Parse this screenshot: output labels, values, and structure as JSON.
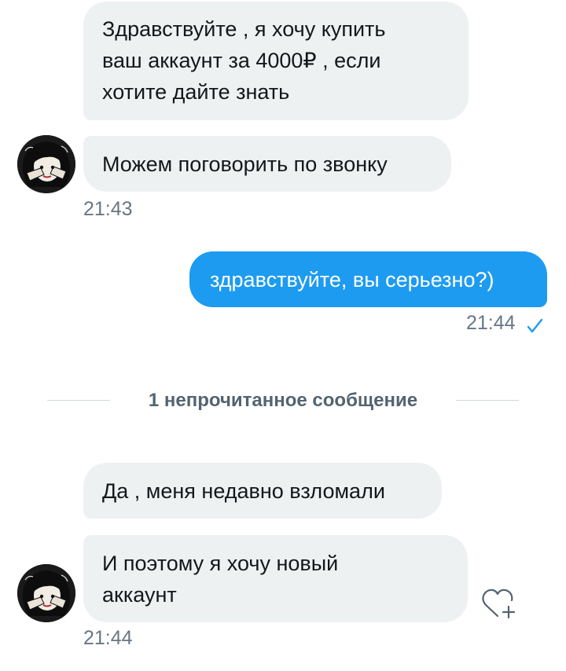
{
  "conversation": {
    "messages": [
      {
        "direction": "incoming",
        "lines": [
          "Здравствуйте , я хочу купить",
          "ваш аккаунт за 4000₽ , если",
          "хотите дайте знать"
        ]
      },
      {
        "direction": "incoming",
        "lines": [
          "Можем поговорить по звонку"
        ],
        "time": "21:43"
      },
      {
        "direction": "outgoing",
        "lines": [
          "здравствуйте, вы серьезно?)"
        ],
        "time": "21:44",
        "status_icon": "check-icon"
      },
      {
        "direction": "incoming",
        "lines": [
          "Да , меня недавно взломали"
        ]
      },
      {
        "direction": "incoming",
        "lines": [
          "И поэтому я хочу новый",
          "аккаунт"
        ],
        "time": "21:44"
      }
    ],
    "unread_divider": "1 непрочитанное сообщение",
    "react_icon": "heart-plus-icon"
  },
  "colors": {
    "incoming_bubble": "#eef1f2",
    "outgoing_bubble": "#1d9bf0",
    "timestamp": "#687684",
    "check": "#1d9bf0"
  }
}
